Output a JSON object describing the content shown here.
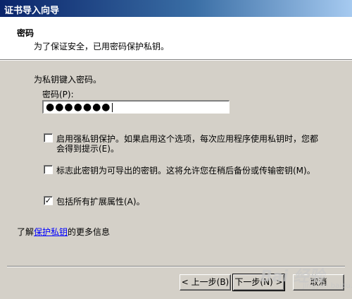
{
  "window": {
    "title": "证书导入向导"
  },
  "header": {
    "title": "密码",
    "subtitle": "为了保证安全，已用密码保护私钥。"
  },
  "body": {
    "instruction": "为私钥键入密码。",
    "password_label": "密码(P):",
    "password_value": "●●●●●●●",
    "options": [
      {
        "label_line1": "启用强私钥保护。如果启用这个选项，每次应用程序使用私钥时，您都",
        "label_line2": "会得到提示(E)。",
        "checked": false,
        "mark": ""
      },
      {
        "label_line1": "标志此密钥为可导出的密钥。这将允许您在稍后备份或传输密钥(M)。",
        "checked": false,
        "mark": ""
      },
      {
        "label_line1": "包括所有扩展属性(A)。",
        "checked": true,
        "mark": "✓"
      }
    ],
    "more_info_prefix": "了解",
    "more_info_link": "保护私钥",
    "more_info_suffix": "的更多信息"
  },
  "buttons": {
    "back": "< 上一步(B)",
    "next": "下一步(N) >",
    "cancel": "取消"
  },
  "watermark": {
    "text": "Bai 经验",
    "sub": "jingyan.baidu.com"
  }
}
